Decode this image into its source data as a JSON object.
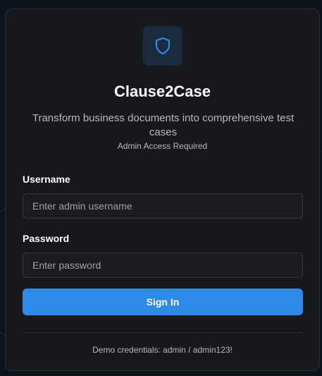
{
  "app": {
    "title": "Clause2Case",
    "subtitle": "Transform business documents into comprehensive test cases",
    "access_note": "Admin Access Required",
    "logo_icon": "shield-icon",
    "accent_color": "#2e8ae6"
  },
  "form": {
    "username": {
      "label": "Username",
      "placeholder": "Enter admin username",
      "value": ""
    },
    "password": {
      "label": "Password",
      "placeholder": "Enter password",
      "value": ""
    },
    "submit_label": "Sign In"
  },
  "footer": {
    "demo_text": "Demo credentials: admin / admin123!"
  }
}
